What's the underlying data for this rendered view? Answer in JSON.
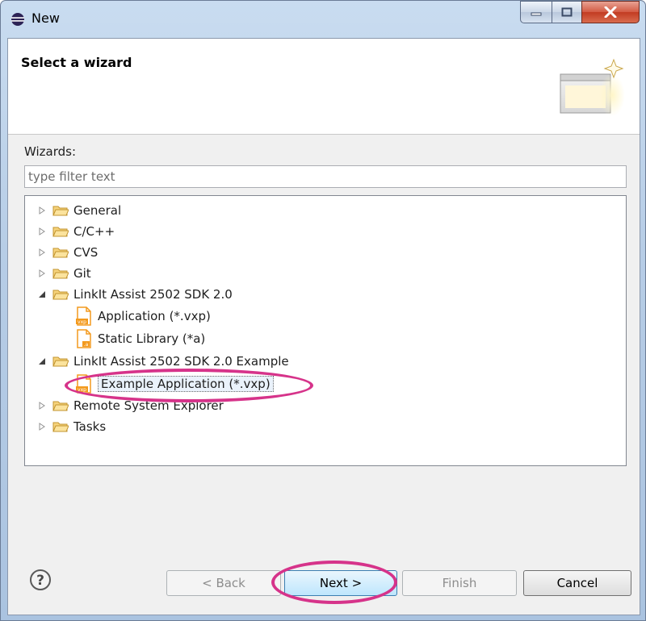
{
  "window": {
    "title": "New"
  },
  "header": {
    "title": "Select a wizard"
  },
  "wizards": {
    "label": "Wizards:",
    "filter_placeholder": "type filter text",
    "tree": [
      {
        "label": "General",
        "kind": "folder",
        "expanded": false,
        "level": 0
      },
      {
        "label": "C/C++",
        "kind": "folder",
        "expanded": false,
        "level": 0
      },
      {
        "label": "CVS",
        "kind": "folder",
        "expanded": false,
        "level": 0
      },
      {
        "label": "Git",
        "kind": "folder",
        "expanded": false,
        "level": 0
      },
      {
        "label": "LinkIt Assist 2502 SDK 2.0",
        "kind": "folder",
        "expanded": true,
        "level": 0
      },
      {
        "label": "Application (*.vxp)",
        "kind": "file",
        "badge": "vxp",
        "level": 1
      },
      {
        "label": "Static Library (*a)",
        "kind": "file",
        "badge": ".a",
        "level": 1
      },
      {
        "label": "LinkIt Assist 2502 SDK 2.0 Example",
        "kind": "folder",
        "expanded": true,
        "level": 0
      },
      {
        "label": "Example Application (*.vxp)",
        "kind": "file",
        "badge": "vxp",
        "level": 1,
        "selected": true
      },
      {
        "label": "Remote System Explorer",
        "kind": "folder",
        "expanded": false,
        "level": 0
      },
      {
        "label": "Tasks",
        "kind": "folder",
        "expanded": false,
        "level": 0
      }
    ]
  },
  "buttons": {
    "back": "< Back",
    "next": "Next >",
    "finish": "Finish",
    "cancel": "Cancel"
  },
  "colors": {
    "annotation": "#d6338a",
    "folder": "#e8b24a",
    "file_badge": "#f39a1e"
  }
}
